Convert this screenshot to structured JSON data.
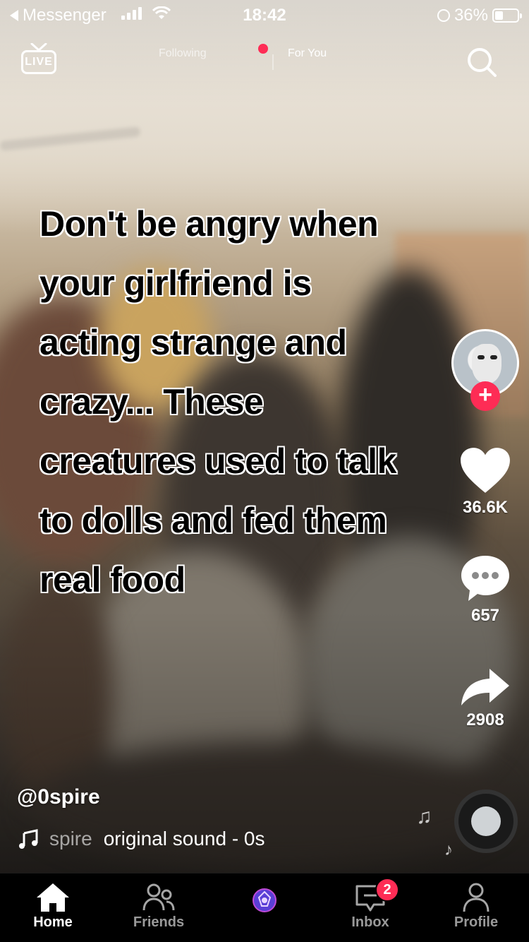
{
  "status_bar": {
    "back_app": "Messenger",
    "time": "18:42",
    "battery": "36%"
  },
  "top_nav": {
    "live_label": "LIVE",
    "following": "Following",
    "for_you": "For You"
  },
  "video": {
    "caption_lines": [
      "Don't be angry when",
      "your girlfriend is",
      "acting strange and",
      "crazy... These",
      "creatures used to talk",
      "to dolls and fed them",
      "real food"
    ],
    "username": "@0spire",
    "sound_prefix": "spire",
    "sound_title": "original sound - 0s"
  },
  "actions": {
    "likes": "36.6K",
    "comments": "657",
    "shares": "2908"
  },
  "tab_bar": {
    "home": "Home",
    "friends": "Friends",
    "inbox": "Inbox",
    "inbox_badge": "2",
    "profile": "Profile"
  },
  "colors": {
    "accent": "#fe2c55"
  }
}
